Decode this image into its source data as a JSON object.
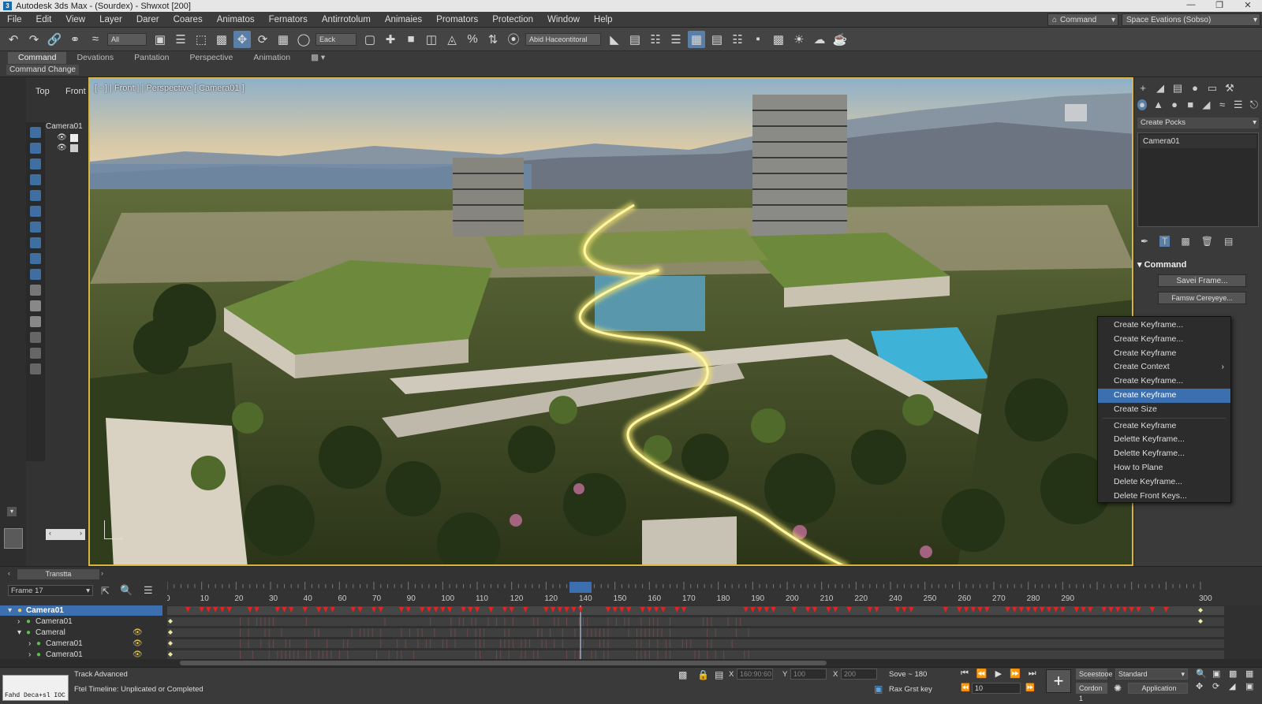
{
  "title": "Autodesk 3ds Max - (Sourdex) - Shwxot [200]",
  "menu": [
    "File",
    "Edit",
    "View",
    "Layer",
    "Darer",
    "Coares",
    "Animatos",
    "Fernators",
    "Antirrotolum",
    "Animaies",
    "Promators",
    "Protection",
    "Window",
    "Help"
  ],
  "workspace": {
    "label": "Command",
    "scene": "Space Evations (Sobso)"
  },
  "toolbar": {
    "selection_filter": "All",
    "ref_coord": "Eack",
    "named_set": "Abid Haceontitoral"
  },
  "ribbon": {
    "tabs": [
      "Command",
      "Devations",
      "Pantation",
      "Perspective",
      "Animation"
    ],
    "sub": "Command Change"
  },
  "left_viewports": {
    "top": "Top",
    "front": "Front"
  },
  "scene_tree": {
    "item": "Camera01"
  },
  "viewport": {
    "label": "[ - ] | Front | | Perspective [ Camera01 ]",
    "axis_x": "x"
  },
  "right_panel": {
    "dropdown": "Create Pocks",
    "list_item": "Camera01",
    "rollout": "Command",
    "btn1": "Savei Frame...",
    "btn2": "Famsw Cereyeye..."
  },
  "context_menu": [
    {
      "label": "Create Keyframe...",
      "arrow": false
    },
    {
      "label": "Create Keyframe...",
      "arrow": false
    },
    {
      "label": "Create Keyframe",
      "arrow": false
    },
    {
      "label": "Create Context",
      "arrow": true
    },
    {
      "label": "Create Keyframe...",
      "arrow": false
    },
    {
      "label": "Create Keyframe",
      "arrow": false,
      "highlight": true
    },
    {
      "label": "Create Size",
      "arrow": false,
      "sep_after": true
    },
    {
      "label": "Create Keyframe",
      "arrow": false
    },
    {
      "label": "Delette Keyframe...",
      "arrow": false
    },
    {
      "label": "Delette Keyframe...",
      "arrow": false
    },
    {
      "label": "How to Plane",
      "arrow": false
    },
    {
      "label": "Delete Keyframe...",
      "arrow": false
    },
    {
      "label": "Delete Front Keys...",
      "arrow": false
    }
  ],
  "timeline": {
    "slider": "Transtta",
    "frame_dropdown": "Frame 17",
    "ticks": [
      0,
      10,
      20,
      30,
      40,
      60,
      70,
      90,
      100,
      110,
      120,
      120,
      140,
      150,
      160,
      170,
      180,
      190,
      200,
      210,
      220,
      240,
      250,
      260,
      270,
      280,
      290,
      300
    ],
    "current_frame": 120
  },
  "tracks": [
    {
      "name": "Camera01",
      "level": 0,
      "selected": true
    },
    {
      "name": "Camera01",
      "level": 1
    },
    {
      "name": "Cameral",
      "level": 1
    },
    {
      "name": "Camera01",
      "level": 2
    },
    {
      "name": "Camera01",
      "level": 2
    }
  ],
  "status": {
    "command_text": "Fahd Deca+sl IOC",
    "track": "Track Advanced",
    "message": "Ftel Timeline: Unplicated or Completed",
    "x_label": "X",
    "x": "160:90:60",
    "y_label": "Y",
    "y": "100",
    "z_label": "X",
    "z": "200",
    "save": "Sove  ~  180",
    "addkey": "Rax Grst key",
    "frame": "10",
    "schedule": "Sceestooe",
    "mode": "Standard",
    "cordion": "Cordon 1",
    "application": "Application"
  },
  "colors": {
    "accent": "#3c6fb0",
    "viewport_border": "#d6b640",
    "key": "#e02424"
  }
}
